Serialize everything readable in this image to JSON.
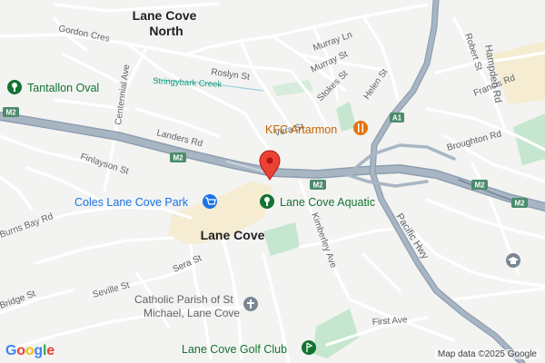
{
  "map": {
    "suburbs": {
      "lane_cove_north": "Lane Cove\nNorth",
      "lane_cove": "Lane Cove"
    },
    "streets": {
      "gordon_cres": "Gordon Cres",
      "centennial_ave": "Centennial Ave",
      "roslyn_st": "Roslyn St",
      "murray_ln": "Murray Ln",
      "murray_st": "Murray St",
      "stokes_st": "Stokes St",
      "helen_st": "Helen St",
      "hampden_rd": "Hampden Rd",
      "robert_st": "Robert St",
      "francis_rd": "Francis Rd",
      "broughton_rd": "Broughton Rd",
      "landers_rd": "Landers Rd",
      "finlayson_st": "Finlayson St",
      "burns_bay_rd": "Burns Bay Rd",
      "sera_st": "Sera St",
      "seville_st": "Seville St",
      "bridge_st": "Bridge St",
      "kimberley_ave": "Kimberley Ave",
      "pacific_hwy": "Pacific Hwy",
      "first_ave": "First Ave",
      "vera_st": "Vera St"
    },
    "creek": "Stringybark Creek",
    "pois": {
      "tantallon_oval": "Tantallon Oval",
      "kfc_artarmon": "KFC Artarmon",
      "coles": "Coles Lane Cove Park",
      "aquatic": "Lane Cove Aquatic",
      "catholic_parish": "Catholic Parish of St\nMichael, Lane Cove",
      "golf_club": "Lane Cove Golf Club"
    },
    "shields": {
      "m2_left": "M2",
      "m2_center": "M2",
      "m2_mid": "M2",
      "m2_right": "M2",
      "m2_far_right": "M2",
      "a1": "A1"
    }
  },
  "branding": {
    "google": "Google",
    "attribution": "Map data ©2025 Google"
  },
  "colors": {
    "background": "#f3f3f1",
    "road_minor": "#ffffff",
    "motorway": "#a8b6c4",
    "motorway_edge": "#8e9eb0",
    "park": "#c5e6cf",
    "commercial": "#f5ecd2",
    "marker_red": "#ea4335",
    "poi_green": "#137333",
    "poi_blue": "#1a73e8",
    "poi_orange": "#e8710a"
  },
  "icons": {
    "pin": "location-pin-icon",
    "park": "park-icon",
    "shopping": "shopping-cart-icon",
    "food": "fork-knife-icon",
    "church": "church-icon",
    "golf": "golf-icon",
    "school": "school-icon"
  }
}
